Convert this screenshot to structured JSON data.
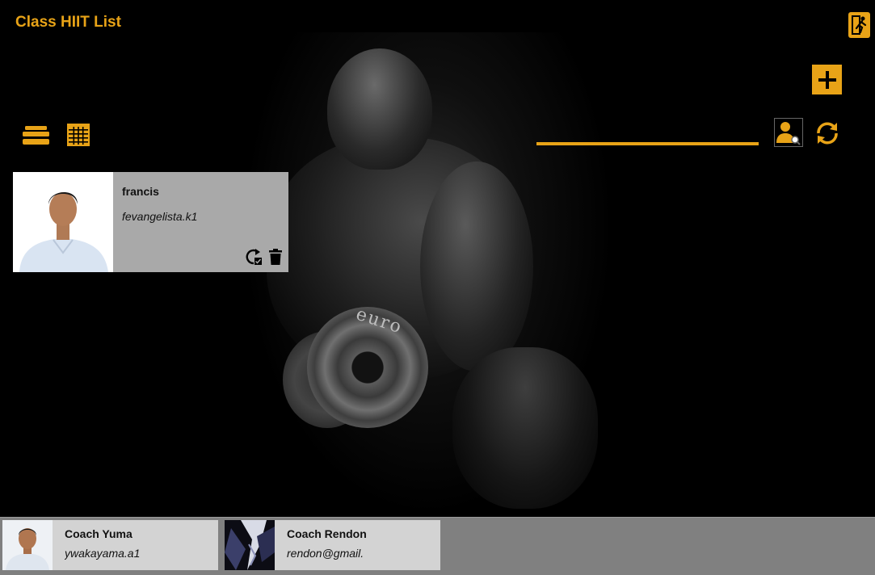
{
  "app": {
    "title": "Class HIIT List"
  },
  "colors": {
    "accent": "#E8A317",
    "card_bg": "#A9A9A9",
    "coach_card_bg": "#D3D3D3",
    "footer_bg": "#808080"
  },
  "toolbar": {
    "exit_icon": "running-exit-icon",
    "add_icon": "plus-icon",
    "card_view_icon": "card-view-icon",
    "grid_view_icon": "grid-view-icon",
    "user_search_icon": "user-search-icon",
    "refresh_icon": "refresh-icon"
  },
  "search": {
    "value": "",
    "placeholder": ""
  },
  "members": [
    {
      "name": "francis",
      "username": "fevangelista.k1",
      "actions": [
        "reassign-icon",
        "trash-icon"
      ]
    }
  ],
  "coaches": [
    {
      "name": "Coach Yuma",
      "username": "ywakayama.a1"
    },
    {
      "name": "Coach Rendon",
      "username": "rendon@gmail."
    }
  ]
}
